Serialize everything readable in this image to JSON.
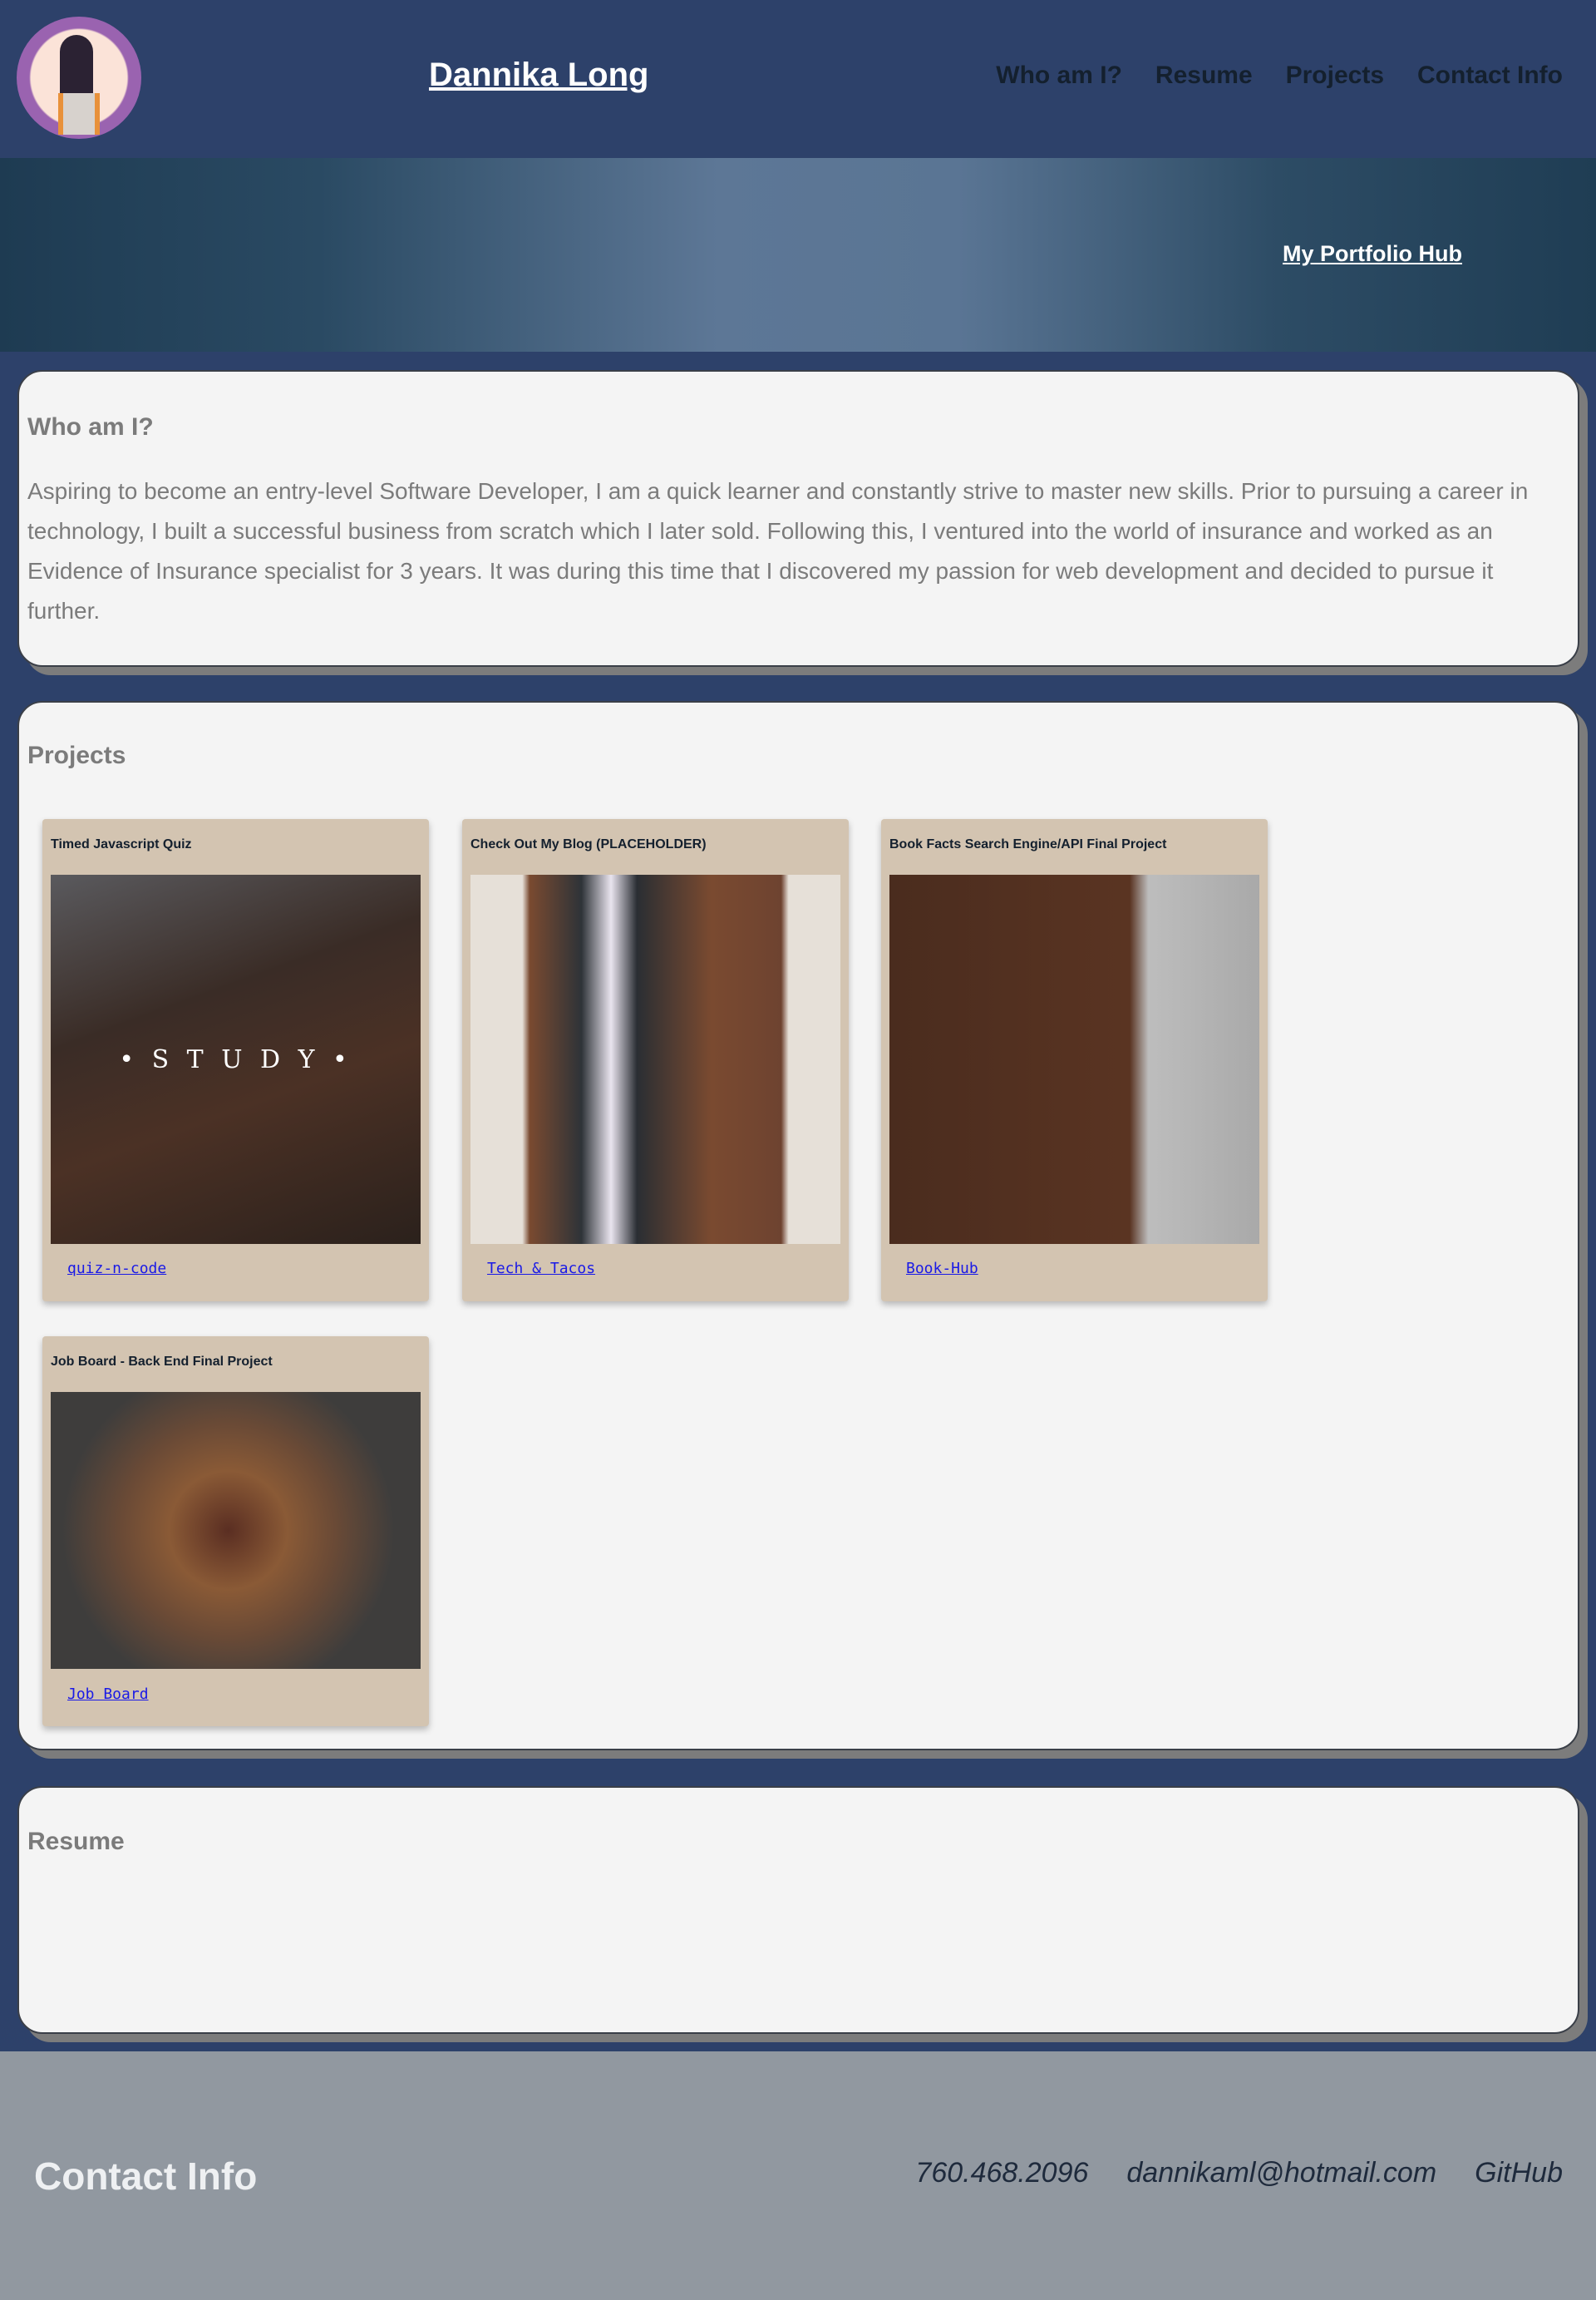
{
  "header": {
    "title": "Dannika Long",
    "nav": [
      "Who am I?",
      "Resume",
      "Projects",
      "Contact Info"
    ]
  },
  "hero": {
    "link": "My Portfolio Hub"
  },
  "about": {
    "heading": "Who am I?",
    "text": "Aspiring to become an entry-level Software Developer, I am a quick learner and constantly strive to master new skills. Prior to pursuing a career in technology, I built a successful business from scratch which I later sold. Following this, I ventured into the world of insurance and worked as an Evidence of Insurance specialist for 3 years. It was during this time that I discovered my passion for web development and decided to pursue it further."
  },
  "projects": {
    "heading": "Projects",
    "items": [
      {
        "title": "Timed Javascript Quiz",
        "link": "quiz-n-code",
        "image_text": "• S T U D Y •"
      },
      {
        "title": "Check Out My Blog (PLACEHOLDER)",
        "link": "Tech & Tacos"
      },
      {
        "title": "Book Facts Search Engine/API Final Project",
        "link": "Book-Hub"
      },
      {
        "title": "Job Board - Back End Final Project",
        "link": "Job Board"
      }
    ]
  },
  "resume": {
    "heading": "Resume"
  },
  "footer": {
    "heading": "Contact Info",
    "phone": "760.468.2096",
    "email": "dannikaml@hotmail.com",
    "github": "GitHub"
  }
}
